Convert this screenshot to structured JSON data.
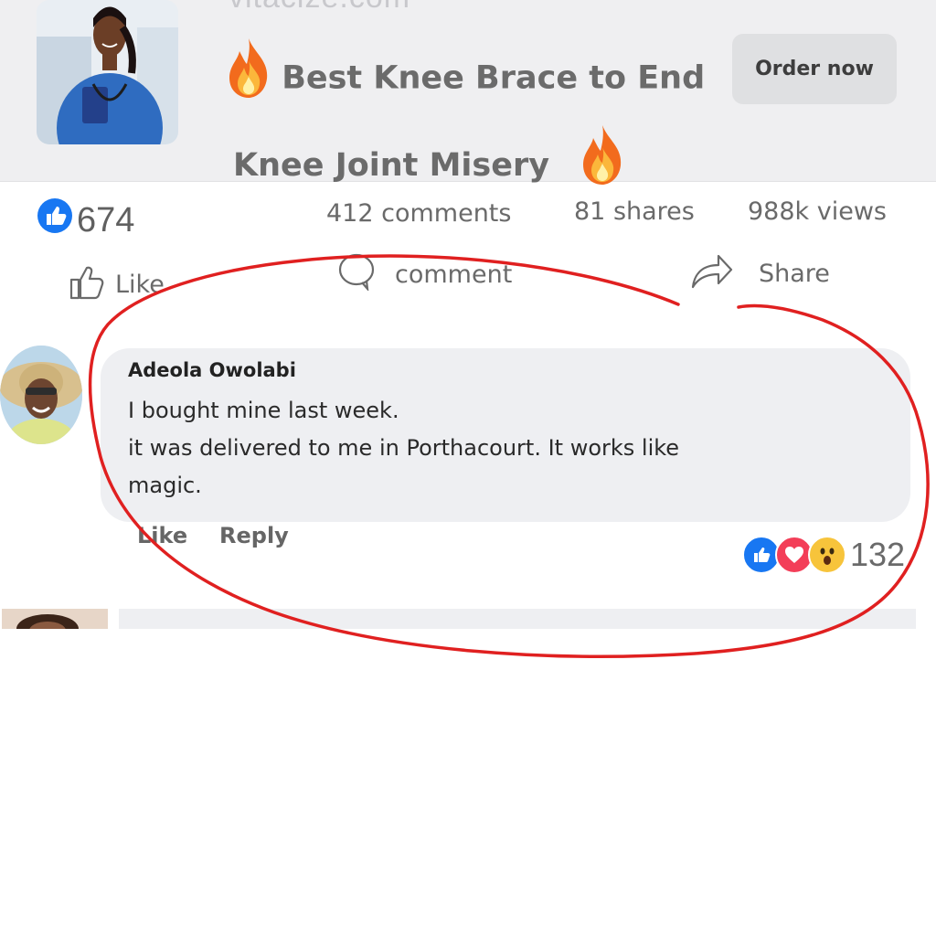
{
  "ad": {
    "domain": "vitacize.com",
    "title_line1": "Best Knee Brace to End",
    "title_line2": "Knee Joint Misery",
    "cta_label": "Order now"
  },
  "post_stats": {
    "like_count": "674",
    "comments": "412 comments",
    "shares": "81 shares",
    "views": "988k views"
  },
  "post_actions": {
    "like_label": "Like",
    "comment_label": "comment",
    "share_label": "Share"
  },
  "comment": {
    "author": "Adeola Owolabi",
    "line1": "I bought mine last week.",
    "line2": "it was delivered to me in Porthacourt. It works like",
    "line3": "magic.",
    "like_label": "Like",
    "reply_label": "Reply",
    "reaction_count": "132",
    "reactions": [
      "like-icon",
      "love-icon",
      "wow-icon"
    ]
  },
  "colors": {
    "facebook_blue": "#1877f2",
    "love_red": "#f33e58",
    "wow_yellow": "#f7c43b",
    "annotation_red": "#e02020"
  }
}
